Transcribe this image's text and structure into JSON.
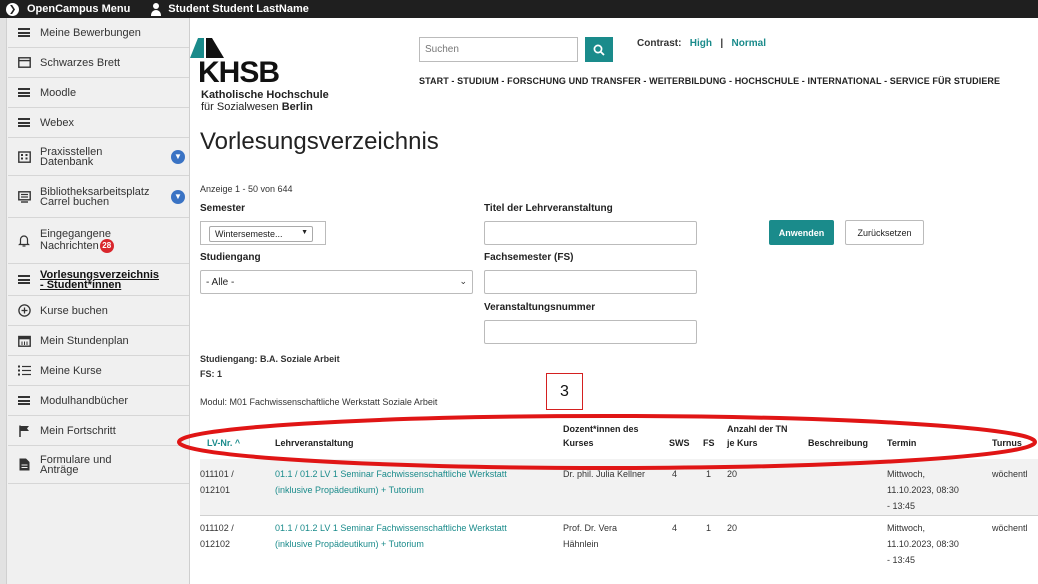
{
  "topbar": {
    "menu_label": "OpenCampus Menu",
    "user_label": "Student Student LastName"
  },
  "sidebar": {
    "items": [
      {
        "label": "Meine Bewerbungen"
      },
      {
        "label": "Schwarzes Brett"
      },
      {
        "label": "Moodle"
      },
      {
        "label": "Webex"
      },
      {
        "label_line1": "Praxisstellen",
        "label_line2": "Datenbank"
      },
      {
        "label_line1": "Bibliotheksarbeitsplatz",
        "label_line2": "Carrel buchen"
      },
      {
        "label_line1": "Eingegangene",
        "label_line2": "Nachrichten",
        "badge": "28"
      },
      {
        "label_line1": "Vorlesungsverzeichnis",
        "label_line2": "- Student*innen"
      },
      {
        "label": "Kurse buchen"
      },
      {
        "label": "Mein Stundenplan"
      },
      {
        "label": "Meine Kurse"
      },
      {
        "label": "Modulhandbücher"
      },
      {
        "label": "Mein Fortschritt"
      },
      {
        "label_line1": "Formulare und",
        "label_line2": "Anträge"
      }
    ]
  },
  "header": {
    "logo_name": "KHSB",
    "logo_sub1": "Katholische Hochschule",
    "logo_sub2_pre": "für Sozialwesen ",
    "logo_sub2_bold": "Berlin",
    "search_placeholder": "Suchen",
    "contrast_label": "Contrast:",
    "contrast_high": "High",
    "contrast_sep": "|",
    "contrast_normal": "Normal",
    "nav": "START  - STUDIUM  - FORSCHUNG UND TRANSFER  - WEITERBILDUNG  - HOCHSCHULE  - INTERNATIONAL  - SERVICE FÜR STUDIERE"
  },
  "page": {
    "title": "Vorlesungsverzeichnis",
    "count": "Anzeige 1 - 50 von 644"
  },
  "filters": {
    "semester_label": "Semester",
    "semester_value": "Wintersemeste...",
    "titel_label": "Titel der Lehrveranstaltung",
    "studiengang_label": "Studiengang",
    "studiengang_value": "- Alle -",
    "fachsemester_label": "Fachsemester (FS)",
    "veranstaltungsnummer_label": "Veranstaltungsnummer",
    "apply_label": "Anwenden",
    "reset_label": "Zurücksetzen"
  },
  "context": {
    "studiengang": "Studiengang: B.A. Soziale Arbeit",
    "fs": "FS: 1",
    "modul": "Modul: M01 Fachwissenschaftliche Werkstatt Soziale Arbeit"
  },
  "annotation": {
    "label": "3"
  },
  "table": {
    "headers": {
      "lvnr": "LV-Nr. ^",
      "lehrveranstaltung": "Lehrveranstaltung",
      "dozent_line1": "Dozent*innen des",
      "dozent_line2": "Kurses",
      "sws": "SWS",
      "fs": "FS",
      "anzahl_line1": "Anzahl der TN",
      "anzahl_line2": "je Kurs",
      "beschreibung": "Beschreibung",
      "termin": "Termin",
      "turnus": "Turnus"
    },
    "rows": [
      {
        "lvnr_line1": "011101 /",
        "lvnr_line2": "012101",
        "title_line1": "01.1 / 01.2 LV 1 Seminar Fachwissenschaftliche Werkstatt",
        "title_line2": "(inklusive Propädeutikum) + Tutorium",
        "dozent_line1": "Dr. phil. Julia Kellner",
        "dozent_line2": "",
        "sws": "4",
        "fs": "1",
        "anzahl": "20",
        "termin_line1": "Mittwoch,",
        "termin_line2": "11.10.2023, 08:30",
        "termin_line3": "- 13:45",
        "turnus": "wöchentl"
      },
      {
        "lvnr_line1": "011102 /",
        "lvnr_line2": "012102",
        "title_line1": "01.1 / 01.2 LV 1 Seminar Fachwissenschaftliche Werkstatt",
        "title_line2": "(inklusive Propädeutikum) + Tutorium",
        "dozent_line1": "Prof. Dr. Vera",
        "dozent_line2": "Hähnlein",
        "sws": "4",
        "fs": "1",
        "anzahl": "20",
        "termin_line1": "Mittwoch,",
        "termin_line2": "11.10.2023, 08:30",
        "termin_line3": "- 13:45",
        "turnus": "wöchentl"
      }
    ]
  },
  "colors": {
    "accent": "#1a8b8b",
    "badge": "#d9262c",
    "annotation": "#e01515",
    "chevron": "#3a73c4"
  }
}
